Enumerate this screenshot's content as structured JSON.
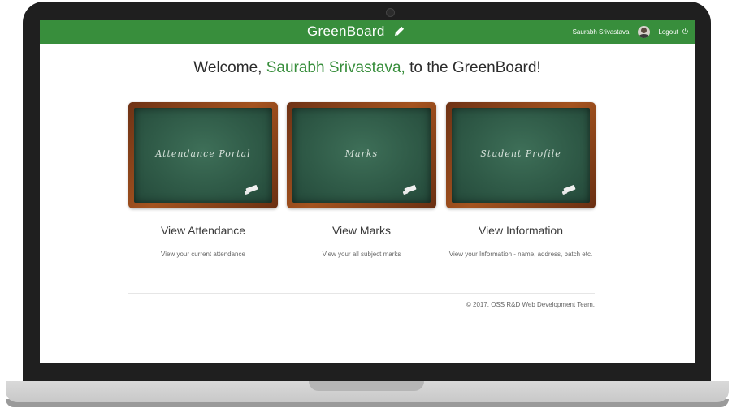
{
  "navbar": {
    "brand": "GreenBoard",
    "user_name": "Saurabh Srivastava",
    "logout_label": "Logout"
  },
  "welcome": {
    "prefix": "Welcome, ",
    "name": "Saurabh Srivastava,",
    "suffix": " to the GreenBoard!"
  },
  "cards": [
    {
      "board_text": "Attendance Portal",
      "title": "View Attendance",
      "description": "View your current attendance"
    },
    {
      "board_text": "Marks",
      "title": "View Marks",
      "description": "View your all subject marks"
    },
    {
      "board_text": "Student Profile",
      "title": "View Information",
      "description": "View your Information - name, address, batch etc."
    }
  ],
  "footer": {
    "text": "© 2017, OSS R&D Web Development Team."
  },
  "colors": {
    "accent": "#388e3c",
    "board_frame": "#a4531f",
    "board_surface": "#2f5a47"
  },
  "icons": {
    "brand": "pencil-icon",
    "logout": "power-icon",
    "board": "chalk-icon"
  }
}
